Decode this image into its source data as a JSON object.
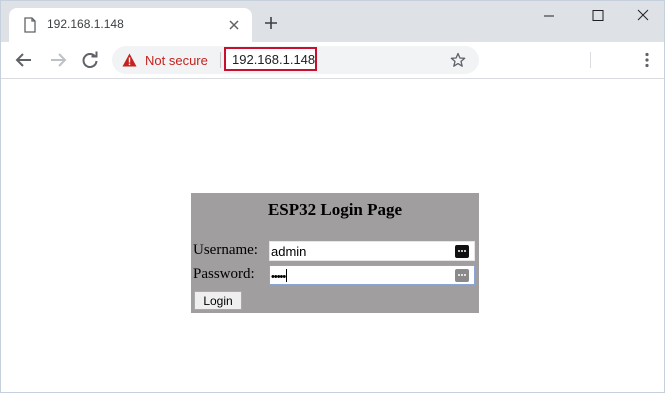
{
  "browser": {
    "tab": {
      "title": "192.168.1.148"
    },
    "omnibox": {
      "security_text": "Not secure",
      "url": "192.168.1.148"
    },
    "icons": [
      "page-icon",
      "close-icon",
      "plus-icon",
      "minimize-icon",
      "maximize-icon",
      "window-close-icon",
      "back-arrow-icon",
      "forward-arrow-icon",
      "reload-icon",
      "warning-icon",
      "star-icon",
      "kebab-menu-icon"
    ],
    "colors": {
      "not_secure": "#c5221f",
      "url_highlight": "#c8102e"
    }
  },
  "page": {
    "title": "ESP32 Login Page",
    "username_label": "Username:",
    "username_value": "admin",
    "password_label": "Password:",
    "password_value": "•••••",
    "login_button": "Login",
    "panel_color": "#a09e9e"
  }
}
